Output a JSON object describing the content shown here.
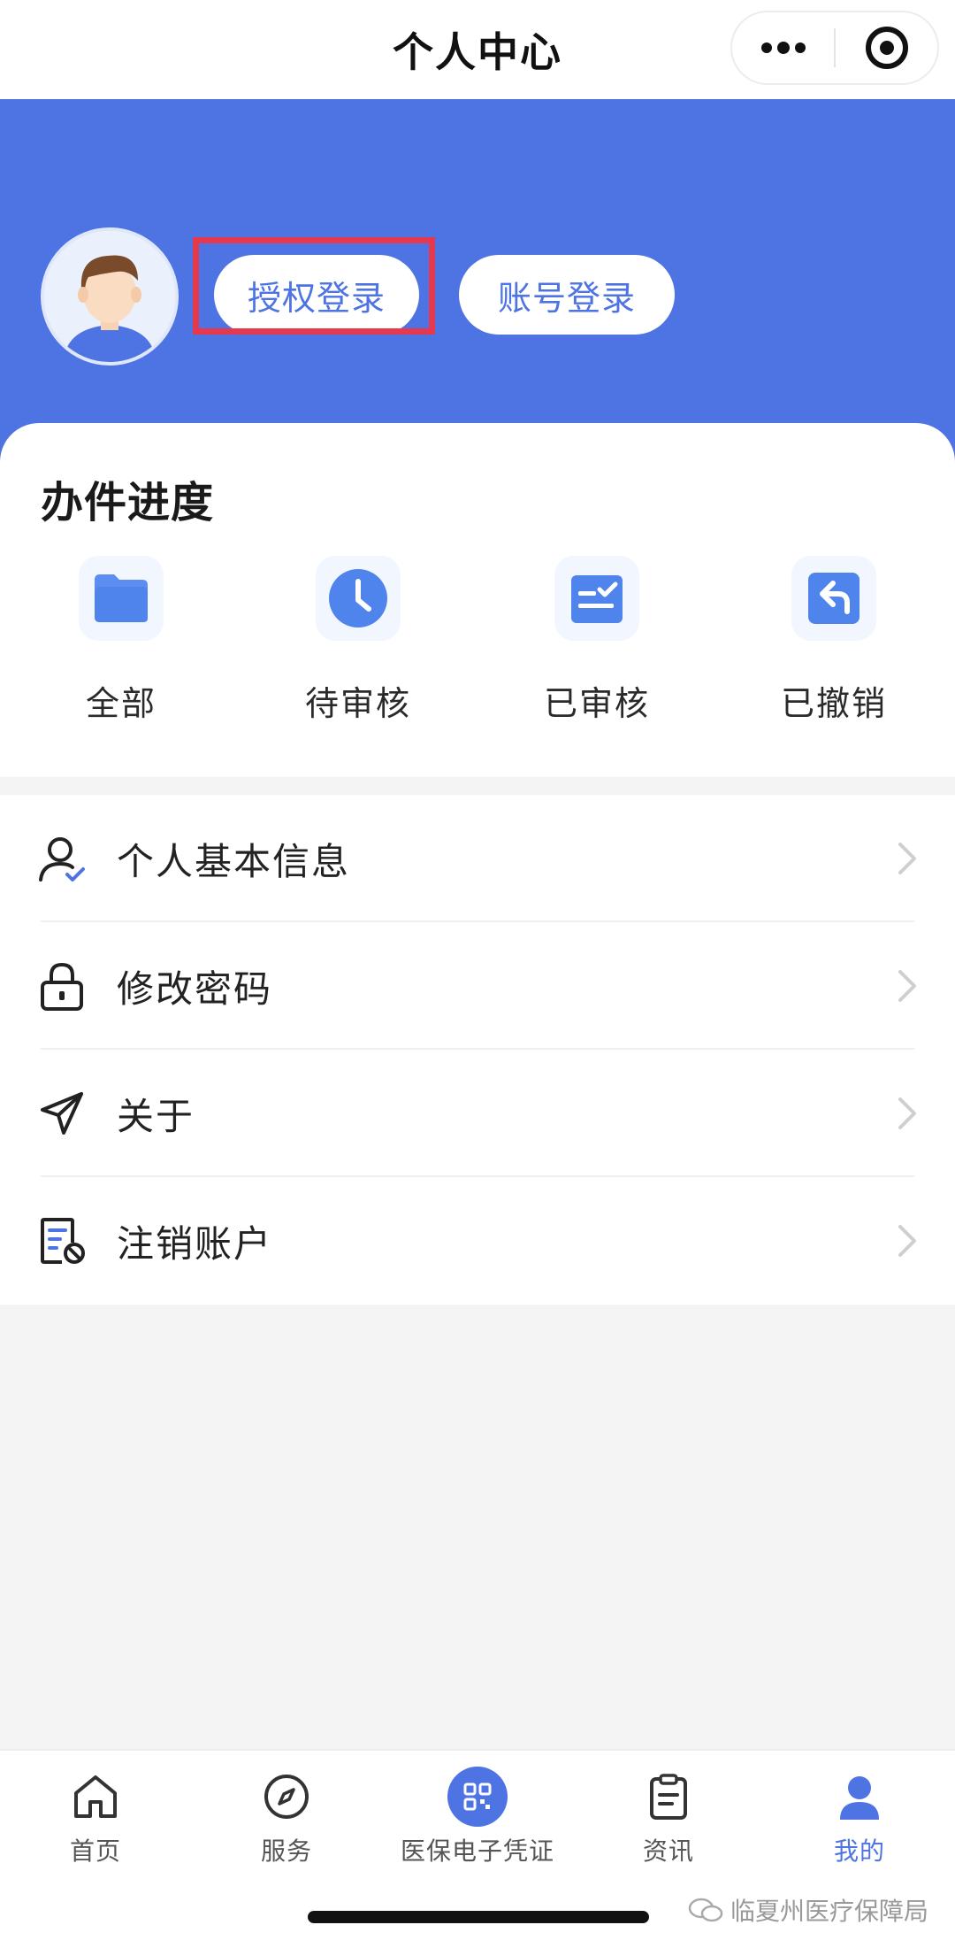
{
  "navbar": {
    "title": "个人中心"
  },
  "header": {
    "auth_login_label": "授权登录",
    "account_login_label": "账号登录"
  },
  "progress": {
    "title": "办件进度",
    "items": [
      {
        "label": "全部",
        "icon": "folder-icon"
      },
      {
        "label": "待审核",
        "icon": "clock-icon"
      },
      {
        "label": "已审核",
        "icon": "approved-doc-icon"
      },
      {
        "label": "已撤销",
        "icon": "undo-icon"
      }
    ]
  },
  "menu": {
    "items": [
      {
        "label": "个人基本信息",
        "icon": "user-check-icon"
      },
      {
        "label": "修改密码",
        "icon": "lock-icon"
      },
      {
        "label": "关于",
        "icon": "send-icon"
      },
      {
        "label": "注销账户",
        "icon": "cancel-account-icon"
      }
    ]
  },
  "tabbar": {
    "items": [
      {
        "label": "首页",
        "icon": "home-icon",
        "active": false
      },
      {
        "label": "服务",
        "icon": "compass-icon",
        "active": false
      },
      {
        "label": "医保电子凭证",
        "icon": "qr-code-icon",
        "active": false
      },
      {
        "label": "资讯",
        "icon": "clipboard-icon",
        "active": false
      },
      {
        "label": "我的",
        "icon": "user-icon",
        "active": true
      }
    ]
  },
  "watermark": {
    "text": "临夏州医疗保障局"
  },
  "colors": {
    "primary": "#4e73e2",
    "highlight": "#e53950",
    "background": "#f4f4f5"
  }
}
